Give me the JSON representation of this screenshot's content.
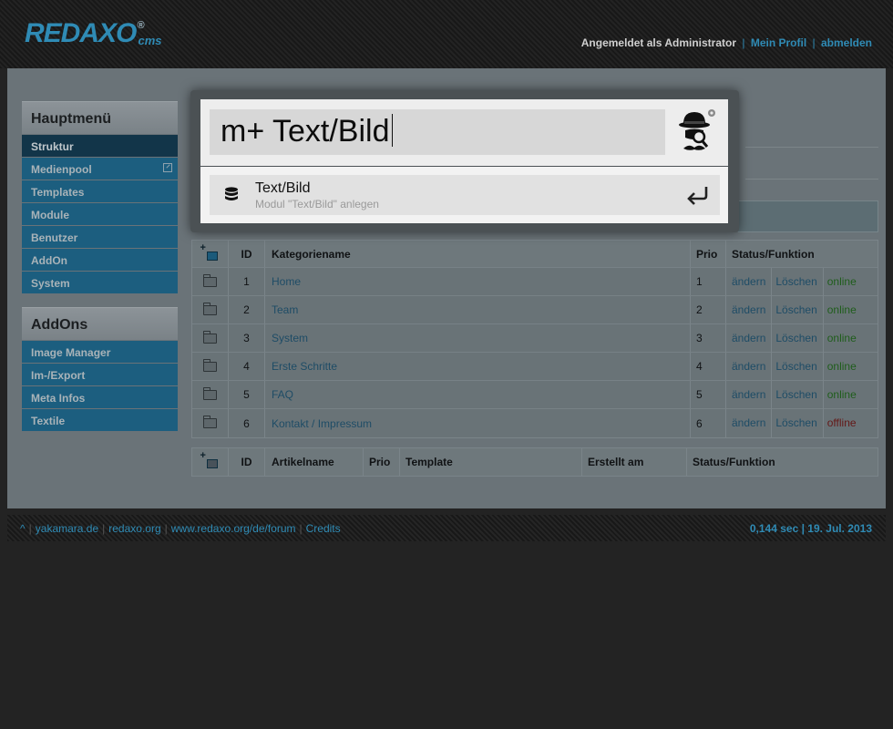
{
  "header": {
    "logo_text": "REDAXO",
    "logo_reg": "®",
    "logo_cms": "cms",
    "logged_in_as": "Angemeldet als Administrator",
    "profile_link": "Mein Profil",
    "logout_link": "abmelden"
  },
  "main_menu": {
    "title": "Hauptmenü",
    "items": [
      {
        "label": "Struktur"
      },
      {
        "label": "Medienpool"
      },
      {
        "label": "Templates"
      },
      {
        "label": "Module"
      },
      {
        "label": "Benutzer"
      },
      {
        "label": "AddOn"
      },
      {
        "label": "System"
      }
    ]
  },
  "addons_menu": {
    "title": "AddOns",
    "items": [
      {
        "label": "Image Manager"
      },
      {
        "label": "Im-/Export"
      },
      {
        "label": "Meta Infos"
      },
      {
        "label": "Textile"
      }
    ]
  },
  "categories": {
    "headers": {
      "id": "ID",
      "name": "Kategoriename",
      "prio": "Prio",
      "status": "Status/Funktion"
    },
    "rows": [
      {
        "id": "1",
        "name": "Home",
        "prio": "1",
        "edit": "ändern",
        "delete": "Löschen",
        "status": "online"
      },
      {
        "id": "2",
        "name": "Team",
        "prio": "2",
        "edit": "ändern",
        "delete": "Löschen",
        "status": "online"
      },
      {
        "id": "3",
        "name": "System",
        "prio": "3",
        "edit": "ändern",
        "delete": "Löschen",
        "status": "online"
      },
      {
        "id": "4",
        "name": "Erste Schritte",
        "prio": "4",
        "edit": "ändern",
        "delete": "Löschen",
        "status": "online"
      },
      {
        "id": "5",
        "name": "FAQ",
        "prio": "5",
        "edit": "ändern",
        "delete": "Löschen",
        "status": "online"
      },
      {
        "id": "6",
        "name": "Kontakt / Impressum",
        "prio": "6",
        "edit": "ändern",
        "delete": "Löschen",
        "status": "offline"
      }
    ]
  },
  "articles": {
    "headers": {
      "id": "ID",
      "name": "Artikelname",
      "prio": "Prio",
      "template": "Template",
      "created": "Erstellt am",
      "status": "Status/Funktion"
    }
  },
  "footer": {
    "top": "^",
    "links": [
      "yakamara.de",
      "redaxo.org",
      "www.redaxo.org/de/forum",
      "Credits"
    ],
    "meta": "0,144 sec | 19. Jul. 2013"
  },
  "quick_nav": {
    "input_value": "m+ Text/Bild",
    "result_title": "Text/Bild",
    "result_subtitle": "Modul \"Text/Bild\" anlegen",
    "result_icon": "database-icon",
    "action_icon": "enter-icon"
  },
  "colors": {
    "accent": "#2f8bb5",
    "menu_item": "#1c5e7f",
    "online": "#1f5d1b",
    "offline": "#641817"
  }
}
